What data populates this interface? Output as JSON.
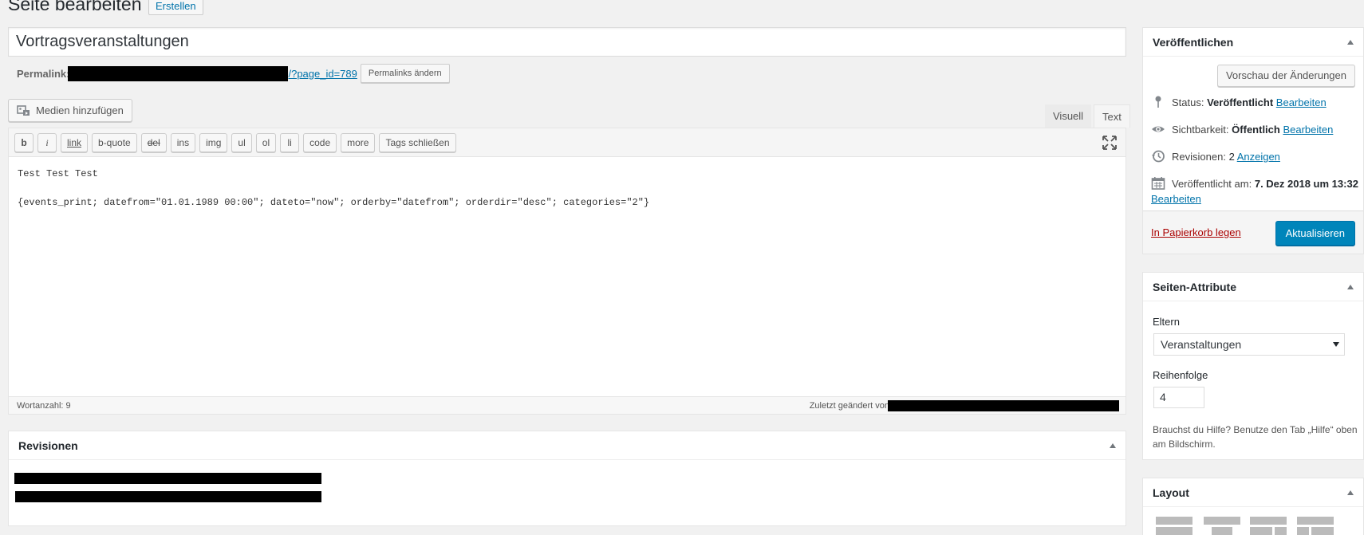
{
  "header": {
    "title": "Seite bearbeiten",
    "add_new": "Erstellen"
  },
  "post": {
    "title": "Vortragsveranstaltungen"
  },
  "permalink": {
    "label": "Permalink:",
    "suffix": "/?page_id=789",
    "change_button": "Permalinks ändern"
  },
  "media": {
    "button": "Medien hinzufügen"
  },
  "editor": {
    "tab_visual": "Visuell",
    "tab_text": "Text",
    "toolbar": [
      "b",
      "i",
      "link",
      "b-quote",
      "del",
      "ins",
      "img",
      "ul",
      "ol",
      "li",
      "code",
      "more",
      "Tags schließen"
    ],
    "content_line1": "Test Test Test",
    "content_line2": "{events_print; datefrom=\"01.01.1989 00:00\"; dateto=\"now\"; orderby=\"datefrom\"; orderdir=\"desc\"; categories=\"2\"}",
    "word_count": "Wortanzahl: 9",
    "last_edited": "Zuletzt geändert von"
  },
  "revisions_box": {
    "title": "Revisionen"
  },
  "publish_box": {
    "title": "Veröffentlichen",
    "preview_button": "Vorschau der Änderungen",
    "status_label": "Status:",
    "status_value": "Veröffentlicht",
    "status_edit": "Bearbeiten",
    "visibility_label": "Sichtbarkeit:",
    "visibility_value": "Öffentlich",
    "visibility_edit": "Bearbeiten",
    "revisions_label": "Revisionen:",
    "revisions_value": "2",
    "revisions_link": "Anzeigen",
    "published_label": "Veröffentlicht am:",
    "published_value": "7. Dez 2018 um 13:32",
    "published_edit": "Bearbeiten",
    "trash": "In Papierkorb legen",
    "update": "Aktualisieren"
  },
  "attributes_box": {
    "title": "Seiten-Attribute",
    "parent_label": "Eltern",
    "parent_value": "Veranstaltungen",
    "order_label": "Reihenfolge",
    "order_value": "4",
    "help_text": "Brauchst du Hilfe? Benutze den Tab „Hilfe“ oben am Bildschirm."
  },
  "layout_box": {
    "title": "Layout"
  },
  "colors": {
    "primary": "#0085ba",
    "link": "#0073aa",
    "trash": "#a00000",
    "background": "#f1f1f1"
  }
}
